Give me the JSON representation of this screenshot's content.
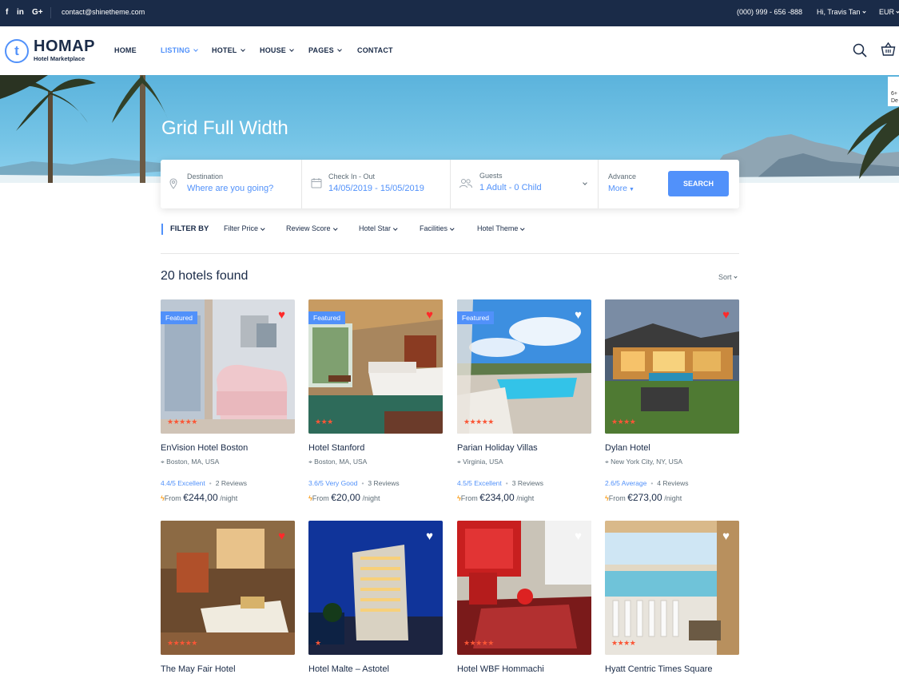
{
  "topbar": {
    "social": [
      "f",
      "in",
      "G+"
    ],
    "email": "contact@shinetheme.com",
    "phone": "(000) 999 - 656 -888",
    "user": "Hi, Travis Tan",
    "currency": "EUR"
  },
  "logo": {
    "mark": "t",
    "name": "HOMAP",
    "tagline": "Hotel Marketplace"
  },
  "nav": [
    {
      "label": "HOME",
      "dropdown": false
    },
    {
      "label": "LISTING",
      "dropdown": true,
      "active": true
    },
    {
      "label": "HOTEL",
      "dropdown": true
    },
    {
      "label": "HOUSE",
      "dropdown": true
    },
    {
      "label": "PAGES",
      "dropdown": true
    },
    {
      "label": "CONTACT",
      "dropdown": false
    }
  ],
  "hero": {
    "title": "Grid Full Width",
    "side_tab": [
      "6+",
      "De"
    ]
  },
  "search": {
    "destination": {
      "label": "Destination",
      "placeholder": "Where are you going?"
    },
    "dates": {
      "label": "Check In - Out",
      "value": "14/05/2019 - 15/05/2019"
    },
    "guests": {
      "label": "Guests",
      "value": "1 Adult - 0 Child"
    },
    "advance": {
      "label": "Advance",
      "value": "More"
    },
    "button": "SEARCH"
  },
  "filters": {
    "title": "FILTER BY",
    "items": [
      "Filter Price",
      "Review Score",
      "Hotel Star",
      "Facilities",
      "Hotel Theme"
    ]
  },
  "results": {
    "count_text": "20 hotels found",
    "sort": "Sort"
  },
  "hotels": [
    {
      "name": "EnVision Hotel Boston",
      "location": "Boston, MA, USA",
      "score": "4.4/5 Excellent",
      "reviews": "2 Reviews",
      "from": "From",
      "price": "€244,00",
      "per": "/night",
      "featured": "Featured",
      "stars": 5,
      "liked": true
    },
    {
      "name": "Hotel Stanford",
      "location": "Boston, MA, USA",
      "score": "3.6/5 Very Good",
      "reviews": "3 Reviews",
      "from": "From",
      "price": "€20,00",
      "per": "/night",
      "featured": "Featured",
      "stars": 3,
      "liked": true
    },
    {
      "name": "Parian Holiday Villas",
      "location": "Virginia, USA",
      "score": "4.5/5 Excellent",
      "reviews": "3 Reviews",
      "from": "From",
      "price": "€234,00",
      "per": "/night",
      "featured": "Featured",
      "stars": 5,
      "liked": false
    },
    {
      "name": "Dylan Hotel",
      "location": "New York City, NY, USA",
      "score": "2.6/5 Average",
      "reviews": "4 Reviews",
      "from": "From",
      "price": "€273,00",
      "per": "/night",
      "featured": "",
      "stars": 4,
      "liked": true
    },
    {
      "name": "The May Fair Hotel",
      "stars": 5,
      "liked": true,
      "featured": ""
    },
    {
      "name": "Hotel Malte – Astotel",
      "stars": 1,
      "liked": false,
      "featured": ""
    },
    {
      "name": "Hotel WBF Hommachi",
      "stars": 5,
      "liked": false,
      "featured": ""
    },
    {
      "name": "Hyatt Centric Times Square",
      "stars": 4,
      "liked": false,
      "featured": ""
    }
  ],
  "colors": {
    "primary": "#5191fa",
    "navy": "#1a2b48",
    "star": "#fa5636",
    "heart_liked": "#ff2a2a"
  }
}
